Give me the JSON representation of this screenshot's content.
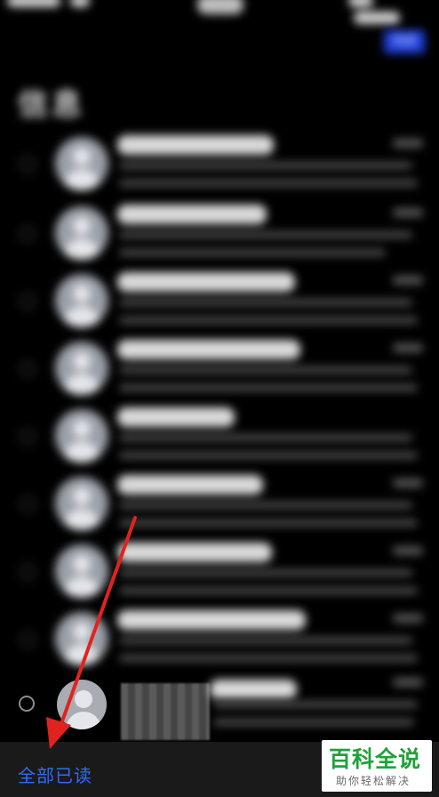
{
  "header": {
    "title": "信息",
    "edit_label": "完成"
  },
  "messages": {
    "rows": [
      {
        "name_width": 176
      },
      {
        "name_width": 168
      },
      {
        "name_width": 200
      },
      {
        "name_width": 206
      },
      {
        "name_width": 132
      },
      {
        "name_width": 164
      },
      {
        "name_width": 174
      },
      {
        "name_width": 212
      }
    ]
  },
  "toolbar": {
    "mark_all_read_label": "全部已读"
  },
  "watermark": {
    "brand": "百科全说",
    "slogan": "助你轻松解决"
  },
  "colors": {
    "accent": "#2f6df6",
    "annotation_arrow": "#e0231f",
    "watermark_green": "#20a13a"
  },
  "icons": {
    "avatar": "person-silhouette-icon",
    "selection": "radio-circle-icon"
  }
}
